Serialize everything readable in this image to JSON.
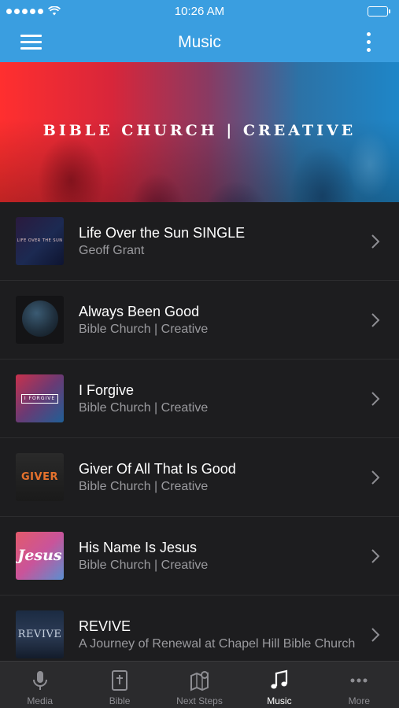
{
  "status_bar": {
    "time": "10:26 AM"
  },
  "app_bar": {
    "title": "Music"
  },
  "banner": {
    "text": "BIBLE CHURCH | CREATIVE"
  },
  "tracks": [
    {
      "title": "Life Over the Sun SINGLE",
      "subtitle": "Geoff Grant",
      "art_text": "LIFE OVER THE SUN"
    },
    {
      "title": "Always Been Good",
      "subtitle": "Bible Church | Creative",
      "art_text": ""
    },
    {
      "title": "I Forgive",
      "subtitle": "Bible Church | Creative",
      "art_text": "I FORGIVE"
    },
    {
      "title": "Giver Of All That Is Good",
      "subtitle": "Bible Church | Creative",
      "art_text": "GIVER"
    },
    {
      "title": "His Name Is Jesus",
      "subtitle": "Bible Church | Creative",
      "art_text": "Jesus"
    },
    {
      "title": "REVIVE",
      "subtitle": "A Journey of Renewal at Chapel Hill Bible Church",
      "art_text": "REVIVE"
    }
  ],
  "tabs": [
    {
      "label": "Media",
      "icon": "microphone-icon",
      "active": false
    },
    {
      "label": "Bible",
      "icon": "bible-icon",
      "active": false
    },
    {
      "label": "Next Steps",
      "icon": "map-pin-icon",
      "active": false
    },
    {
      "label": "Music",
      "icon": "music-note-icon",
      "active": true
    },
    {
      "label": "More",
      "icon": "more-dots-icon",
      "active": false
    }
  ],
  "colors": {
    "accent": "#3a9ee0",
    "list_bg": "#1d1d1f",
    "tab_bar_bg": "#2b2b2d",
    "subtitle": "#9a9a9e"
  }
}
